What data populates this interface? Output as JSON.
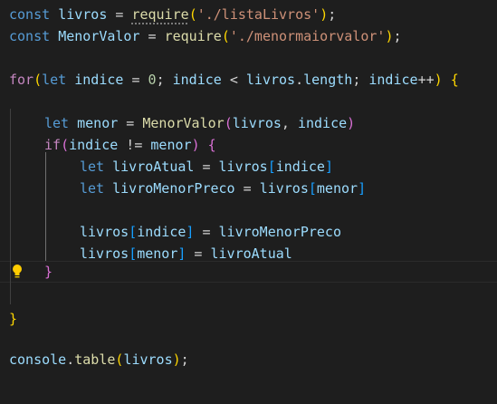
{
  "editor": {
    "colors": {
      "background": "#1e1e1e",
      "keyword": "#569cd6",
      "control": "#c586c0",
      "variable": "#9cdcfe",
      "function": "#dcdcaa",
      "string": "#ce9178",
      "number": "#b5cea8",
      "bracket_gold": "#ffd700",
      "bracket_orchid": "#da70d6",
      "bracket_blue": "#179fff"
    },
    "icons": [
      "lightbulb-icon"
    ],
    "tokens": {
      "const": "const",
      "let": "let",
      "for": "for",
      "if": "if",
      "livros": "livros",
      "menorValor": "MenorValor",
      "require": "require",
      "path_lista": "'./listaLivros'",
      "path_menor": "'./menormaiorvalor'",
      "indice": "indice",
      "zero": "0",
      "length": "length",
      "menor": "menor",
      "livroAtual": "livroAtual",
      "livroMenorPreco": "livroMenorPreco",
      "console": "console",
      "table": "table"
    }
  }
}
